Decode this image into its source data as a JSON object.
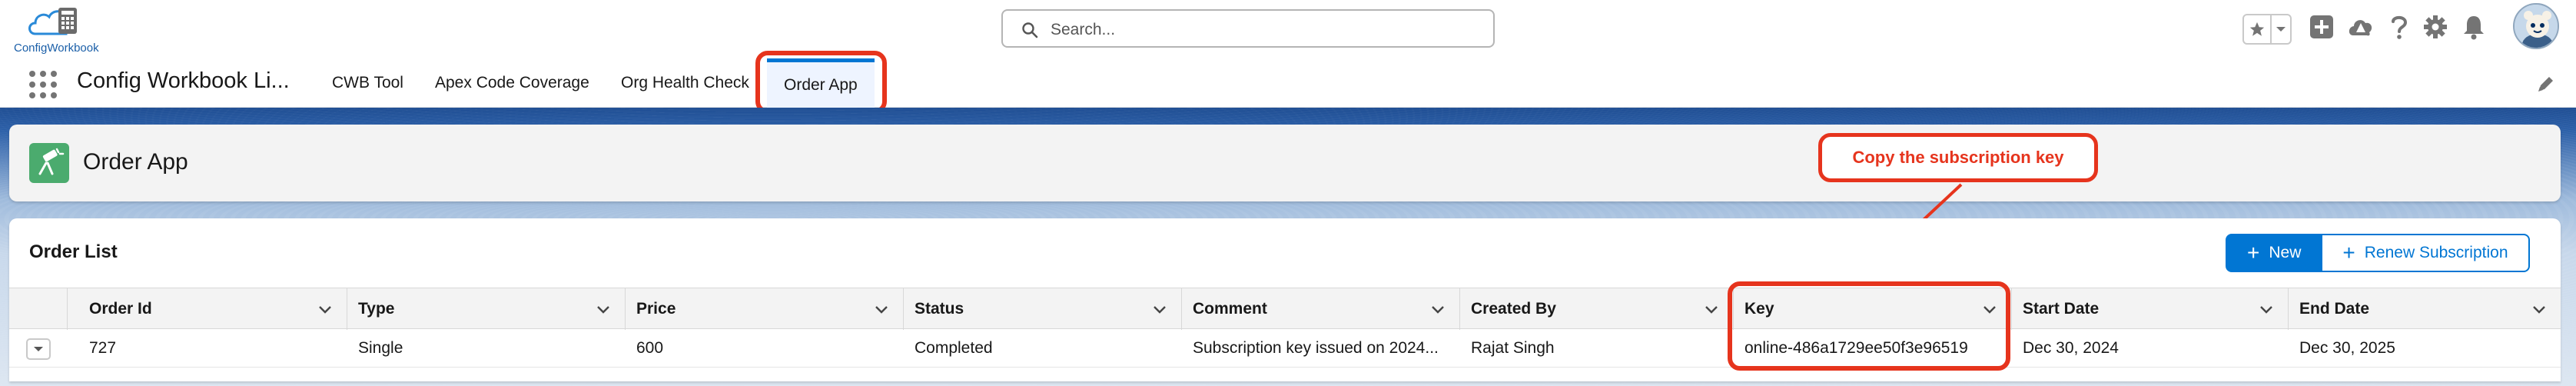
{
  "header": {
    "logo_text_a": "Config",
    "logo_text_b": "Workbook",
    "search_placeholder": "Search..."
  },
  "nav": {
    "app_name": "Config Workbook Li...",
    "tabs": [
      {
        "label": "CWB Tool"
      },
      {
        "label": "Apex Code Coverage"
      },
      {
        "label": "Org Health Check"
      },
      {
        "label": "Order App"
      }
    ]
  },
  "page": {
    "title": "Order App"
  },
  "callout": {
    "text": "Copy the subscription key"
  },
  "list": {
    "title": "Order List",
    "new_label": "New",
    "renew_label": "Renew Subscription",
    "columns": [
      "Order Id",
      "Type",
      "Price",
      "Status",
      "Comment",
      "Created By",
      "Key",
      "Start Date",
      "End Date"
    ],
    "rows": [
      {
        "order_id": "727",
        "type": "Single",
        "price": "600",
        "status": "Completed",
        "comment": "Subscription key issued on 2024...",
        "created_by": "Rajat Singh",
        "key": "online-486a1729ee50f3e96519",
        "start_date": "Dec 30, 2024",
        "end_date": "Dec 30, 2025"
      }
    ]
  },
  "colors": {
    "brand": "#0176d3",
    "annotation": "#e6341d",
    "page_icon": "#4bab6e"
  }
}
